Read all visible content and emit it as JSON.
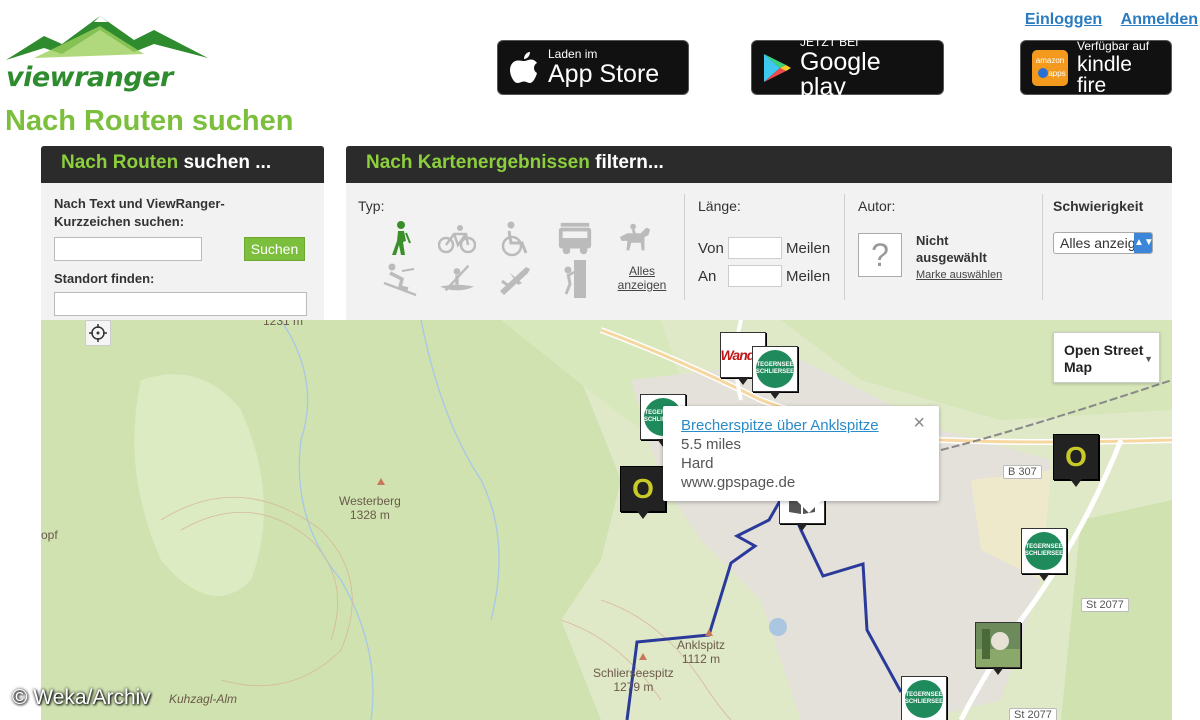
{
  "header": {
    "logo_text": "viewranger",
    "login": "Einloggen",
    "register": "Anmelden"
  },
  "stores": {
    "apple": {
      "small": "Laden im",
      "big": "App Store"
    },
    "google": {
      "small": "JETZT BEI",
      "big": "Google play"
    },
    "kindle": {
      "small": "Verfügbar auf",
      "big": "kindle fire",
      "tag": "amazon apps"
    }
  },
  "page_title": "Nach Routen suchen",
  "search_panel": {
    "title_green": "Nach Routen",
    "title_white": " suchen ...",
    "text_label": "Nach Text und ViewRanger-Kurzzeichen suchen:",
    "search_value": "",
    "search_button": "Suchen",
    "location_label": "Standort finden:",
    "location_value": ""
  },
  "filter_panel": {
    "title_green": "Nach Kartenergebnissen",
    "title_white": " filtern...",
    "type_label": "Typ:",
    "types": [
      "hiking",
      "cycling",
      "wheelchair",
      "vehicle",
      "horse-riding",
      "skiing",
      "kayaking",
      "flying",
      "climbing"
    ],
    "show_all": "Alles anzeigen",
    "length_label": "Länge:",
    "from_label": "Von",
    "to_label": "An",
    "unit": "Meilen",
    "author_label": "Autor:",
    "author_status": "Nicht ausgewählt",
    "author_link": "Marke auswählen",
    "difficulty_label": "Schwierigkeit",
    "difficulty_value": "Alles anzeigen"
  },
  "map": {
    "layer": "Open Street Map",
    "places": [
      {
        "name": "Westerberg",
        "elev": "1328 m"
      },
      {
        "name": "Anklspitz",
        "elev": "1112 m"
      },
      {
        "name": "Schlierseespitz",
        "elev": "1279 m"
      },
      {
        "name": "Kuhzagl-Alm",
        "elev": ""
      },
      {
        "name": "opf",
        "elev": ""
      },
      {
        "name": "1231 m",
        "elev": ""
      }
    ],
    "roads": [
      "B 307",
      "St 2077",
      "St 2077"
    ],
    "marker_zero": "O",
    "brand_wander": "Wander",
    "brand_badge": "TEGERNSEE SCHLIERSEE",
    "popup": {
      "title": "Brecherspitze über Anklspitze",
      "distance": "5.5 miles",
      "difficulty": "Hard",
      "source": "www.gpspage.de",
      "close": "×"
    }
  },
  "watermark": "© Weka/Archiv",
  "colors": {
    "brand_green": "#7cbf3c",
    "link_blue": "#2a7bbf",
    "route": "#2a3a9a",
    "head_bg": "#2b2b2b"
  }
}
